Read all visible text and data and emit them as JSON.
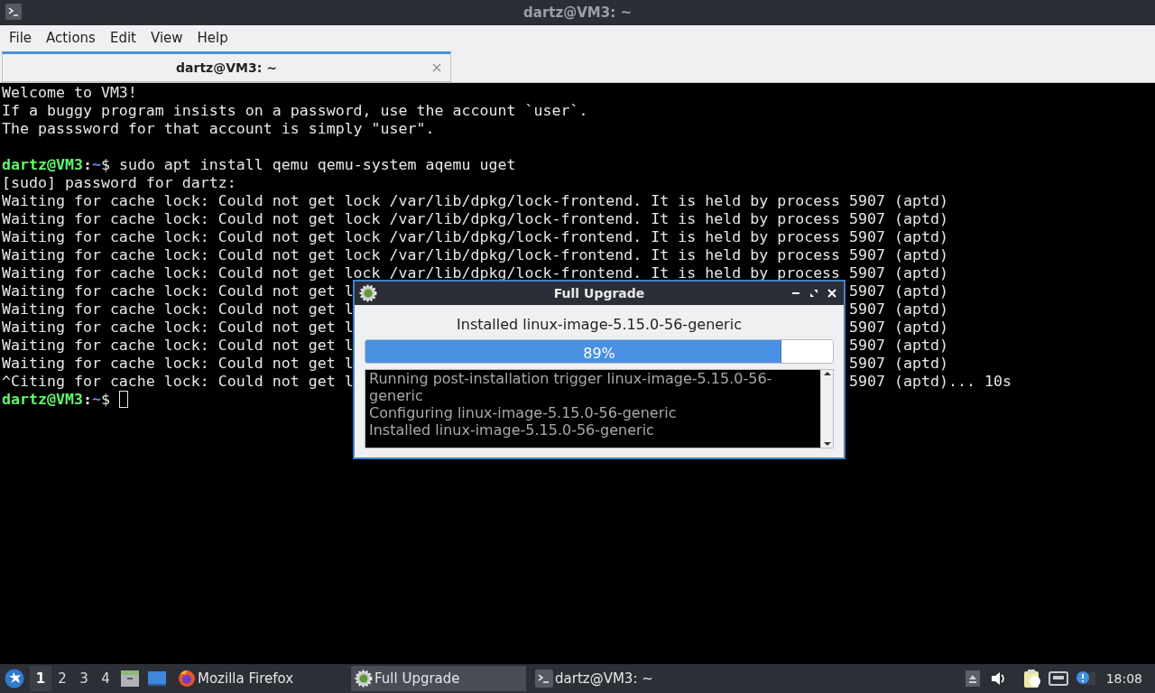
{
  "window": {
    "title": "dartz@VM3: ~"
  },
  "menu": [
    "File",
    "Actions",
    "Edit",
    "View",
    "Help"
  ],
  "tabs": [
    {
      "label": "dartz@VM3: ~",
      "selected": true
    }
  ],
  "terminal": {
    "lines": [
      {
        "kind": "text",
        "text": "Welcome to VM3!"
      },
      {
        "kind": "text",
        "text": "If a buggy program insists on a password, use the account `user`."
      },
      {
        "kind": "text",
        "text": "The passsword for that account is simply \"user\"."
      },
      {
        "kind": "blank"
      },
      {
        "kind": "prompt",
        "user_host": "dartz@VM3",
        "separator": ":",
        "path": "~",
        "symbol": "$",
        "command": "sudo apt install qemu qemu-system aqemu uget"
      },
      {
        "kind": "text",
        "text": "[sudo] password for dartz:"
      },
      {
        "kind": "text",
        "text": "Waiting for cache lock: Could not get lock /var/lib/dpkg/lock-frontend. It is held by process 5907 (aptd)"
      },
      {
        "kind": "text",
        "text": "Waiting for cache lock: Could not get lock /var/lib/dpkg/lock-frontend. It is held by process 5907 (aptd)"
      },
      {
        "kind": "text",
        "text": "Waiting for cache lock: Could not get lock /var/lib/dpkg/lock-frontend. It is held by process 5907 (aptd)"
      },
      {
        "kind": "text",
        "text": "Waiting for cache lock: Could not get lock /var/lib/dpkg/lock-frontend. It is held by process 5907 (aptd)"
      },
      {
        "kind": "text",
        "text": "Waiting for cache lock: Could not get lock /var/lib/dpkg/lock-frontend. It is held by process 5907 (aptd)"
      },
      {
        "kind": "split",
        "text": "Waiting for cache lock: Could not get l",
        "right": "5907 (aptd)"
      },
      {
        "kind": "split",
        "text": "Waiting for cache lock: Could not get l",
        "right": "5907 (aptd)"
      },
      {
        "kind": "split",
        "text": "Waiting for cache lock: Could not get l",
        "right": "5907 (aptd)"
      },
      {
        "kind": "split",
        "text": "Waiting for cache lock: Could not get l",
        "right": "5907 (aptd)"
      },
      {
        "kind": "split",
        "text": "Waiting for cache lock: Could not get l",
        "right": "5907 (aptd)"
      },
      {
        "kind": "split",
        "text": "^Citing for cache lock: Could not get l",
        "right": "5907 (aptd)... 10s"
      },
      {
        "kind": "prompt",
        "user_host": "dartz@VM3",
        "separator": ":",
        "path": "~",
        "symbol": "$",
        "cursor": true
      }
    ]
  },
  "dialog": {
    "title": "Full Upgrade",
    "status": "Installed linux-image-5.15.0-56-generic",
    "progress": {
      "level": 0.89,
      "reading": "89%"
    },
    "log": [
      "Running post-installation trigger linux-image-5.15.0-56-generic",
      "Configuring linux-image-5.15.0-56-generic",
      "Installed linux-image-5.15.0-56-generic"
    ]
  },
  "taskbar": {
    "workspaces": [
      {
        "label": "1",
        "selected": true
      },
      {
        "label": "2",
        "selected": false
      },
      {
        "label": "3",
        "selected": false
      },
      {
        "label": "4",
        "selected": false
      }
    ],
    "tasks": [
      {
        "kind": "firefox",
        "label": "Mozilla Firefox",
        "selected": false
      },
      {
        "kind": "upgrade",
        "label": "Full Upgrade",
        "selected": true
      },
      {
        "kind": "terminal",
        "label": "dartz@VM3: ~",
        "selected": false
      }
    ],
    "clock": "18:08"
  }
}
